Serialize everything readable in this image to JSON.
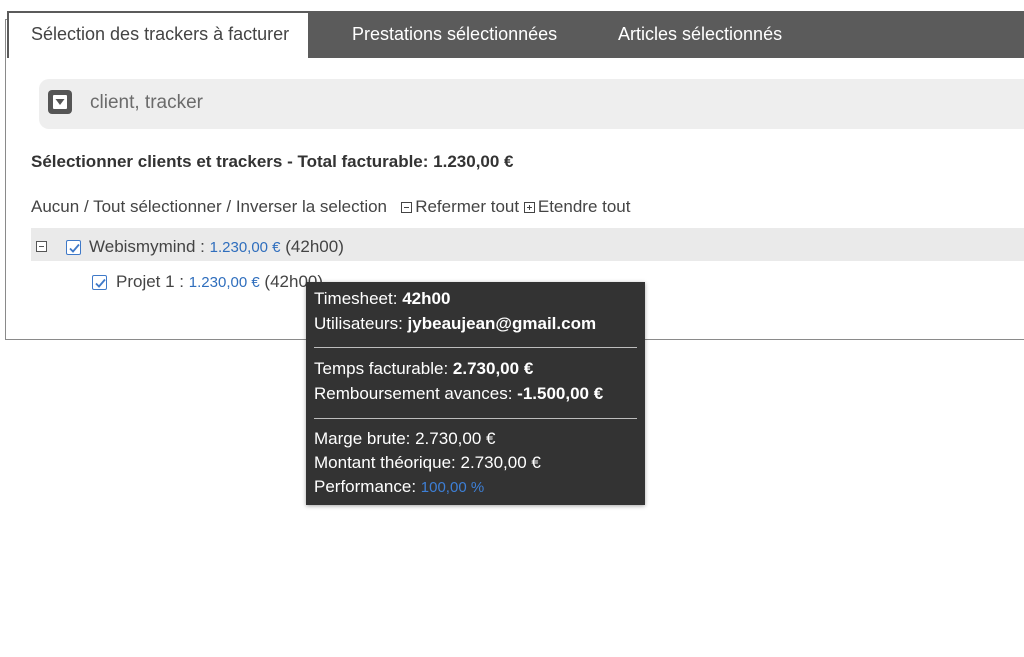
{
  "tabs": [
    {
      "label": "Sélection des trackers à facturer",
      "active": true
    },
    {
      "label": "Prestations sélectionnées",
      "active": false
    },
    {
      "label": "Articles sélectionnés",
      "active": false
    }
  ],
  "search": {
    "placeholder": "client, tracker",
    "icon": "filter-dropdown-icon"
  },
  "heading": "Sélectionner clients et trackers - Total facturable: 1.230,00 €",
  "actions": {
    "none": "Aucun",
    "select_all": "Tout sélectionner",
    "invert": "Inverser la selection",
    "collapse_all": "Refermer tout",
    "expand_all": "Etendre tout"
  },
  "tree": {
    "client": {
      "name": "Webismymind :",
      "amount": "1.230,00 €",
      "hours": "(42h00)",
      "checked": true
    },
    "project": {
      "name": "Projet 1 :",
      "amount": "1.230,00 €",
      "hours": "(42h00)",
      "checked": true
    }
  },
  "tooltip": {
    "timesheet_label": "Timesheet:",
    "timesheet_value": "42h00",
    "users_label": "Utilisateurs:",
    "users_value": "jybeaujean@gmail.com",
    "billable_label": "Temps facturable:",
    "billable_value": "2.730,00 €",
    "advances_label": "Remboursement avances:",
    "advances_value": "-1.500,00 €",
    "gross_margin": "Marge brute: 2.730,00 €",
    "theoretical": "Montant théorique: 2.730,00 €",
    "performance_label": "Performance:",
    "performance_value": "100,00 %"
  },
  "colors": {
    "tabbar": "#5b5b5b",
    "link_amount": "#2f6ebd",
    "tooltip_bg": "#333333",
    "checkbox": "#3f79c8"
  }
}
